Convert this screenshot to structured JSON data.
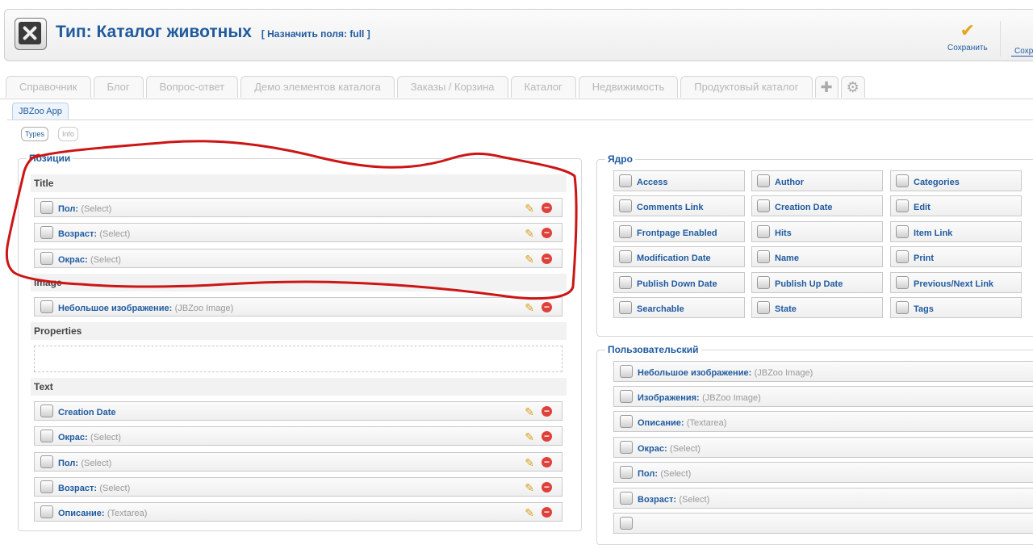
{
  "header": {
    "title": "Тип: Каталог животных",
    "subtitle": "[ Назначить поля: full ]",
    "save_label": "Сохранить",
    "save2_label": "Сохрани"
  },
  "tabs": [
    "Справочник",
    "Блог",
    "Вопрос-ответ",
    "Демо элементов каталога",
    "Заказы / Корзина",
    "Каталог",
    "Недвижимость",
    "Продуктовый каталог"
  ],
  "subtab": "JBZoo App",
  "pills": {
    "types": "Types",
    "info": "Info"
  },
  "positions": {
    "legend": "Позиции",
    "title_group": "Title",
    "title_items": [
      {
        "name": "Пол:",
        "type": "(Select)"
      },
      {
        "name": "Возраст:",
        "type": "(Select)"
      },
      {
        "name": "Окрас:",
        "type": "(Select)"
      }
    ],
    "image_group": "Image",
    "image_items": [
      {
        "name": "Небольшое изображение:",
        "type": "(JBZoo Image)"
      }
    ],
    "properties_group": "Properties",
    "text_group": "Text",
    "text_items": [
      {
        "name": "Creation Date",
        "type": ""
      },
      {
        "name": "Окрас:",
        "type": "(Select)"
      },
      {
        "name": "Пол:",
        "type": "(Select)"
      },
      {
        "name": "Возраст:",
        "type": "(Select)"
      },
      {
        "name": "Описание:",
        "type": "(Textarea)"
      }
    ]
  },
  "core": {
    "legend": "Ядро",
    "items": [
      "Access",
      "Author",
      "Categories",
      "Comments Link",
      "Creation Date",
      "Edit",
      "Frontpage Enabled",
      "Hits",
      "Item Link",
      "Modification Date",
      "Name",
      "Print",
      "Publish Down Date",
      "Publish Up Date",
      "Previous/Next Link",
      "Searchable",
      "State",
      "Tags"
    ]
  },
  "custom": {
    "legend": "Пользовательский",
    "items": [
      {
        "name": "Небольшое изображение:",
        "type": "(JBZoo Image)"
      },
      {
        "name": "Изображения:",
        "type": "(JBZoo Image)"
      },
      {
        "name": "Описание:",
        "type": "(Textarea)"
      },
      {
        "name": "Окрас:",
        "type": "(Select)"
      },
      {
        "name": "Пол:",
        "type": "(Select)"
      },
      {
        "name": "Возраст:",
        "type": "(Select)"
      }
    ]
  }
}
